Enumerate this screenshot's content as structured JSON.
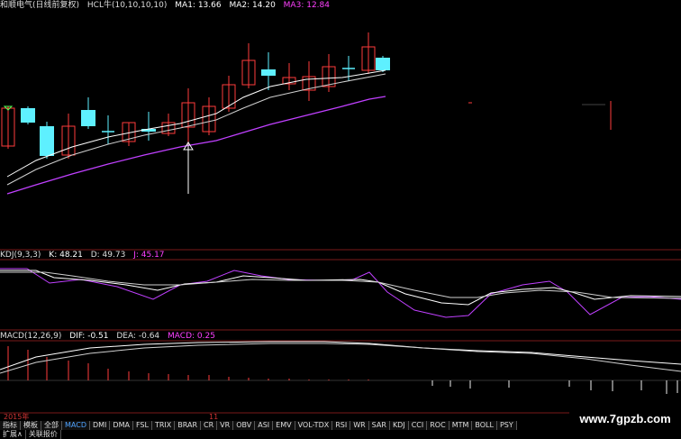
{
  "header": {
    "stock_name": "和顺电气(日线前复权)",
    "indicator_name": "HCL牛(10,10,10,10)",
    "ma1_label": "MA1:",
    "ma1_value": "13.66",
    "ma2_label": "MA2:",
    "ma2_value": "14.20",
    "ma3_label": "MA3:",
    "ma3_value": "12.84"
  },
  "kdj": {
    "label": "KDJ(9,3,3)",
    "k": "K: 48.21",
    "d": "D: 49.73",
    "j": "J: 45.17"
  },
  "macd": {
    "label": "MACD(12,26,9)",
    "dif": "DIF: -0.51",
    "dea": "DEA: -0.64",
    "macd": "MACD: 0.25"
  },
  "date_bar": {
    "year": "2015年",
    "month": "11"
  },
  "tabs": [
    "指标",
    "模板",
    "全部",
    "MACD",
    "DMI",
    "DMA",
    "FSL",
    "TRIX",
    "BRAR",
    "CR",
    "VR",
    "OBV",
    "ASI",
    "EMV",
    "VOL-TDX",
    "RSI",
    "WR",
    "SAR",
    "KDJ",
    "CCI",
    "ROC",
    "MTM",
    "BOLL",
    "PSY"
  ],
  "active_tab": "MACD",
  "bottom_buttons": [
    "扩展∧",
    "关联报价"
  ],
  "watermark": "www.7gpzb.com",
  "colors": {
    "up": "#ff3b3b",
    "down": "#5ef0ff",
    "ma_white": "#ffffff",
    "ma3_purple": "#c040ff",
    "separator": "#7a1a1a",
    "ma3_label": "#ff40ff"
  }
}
